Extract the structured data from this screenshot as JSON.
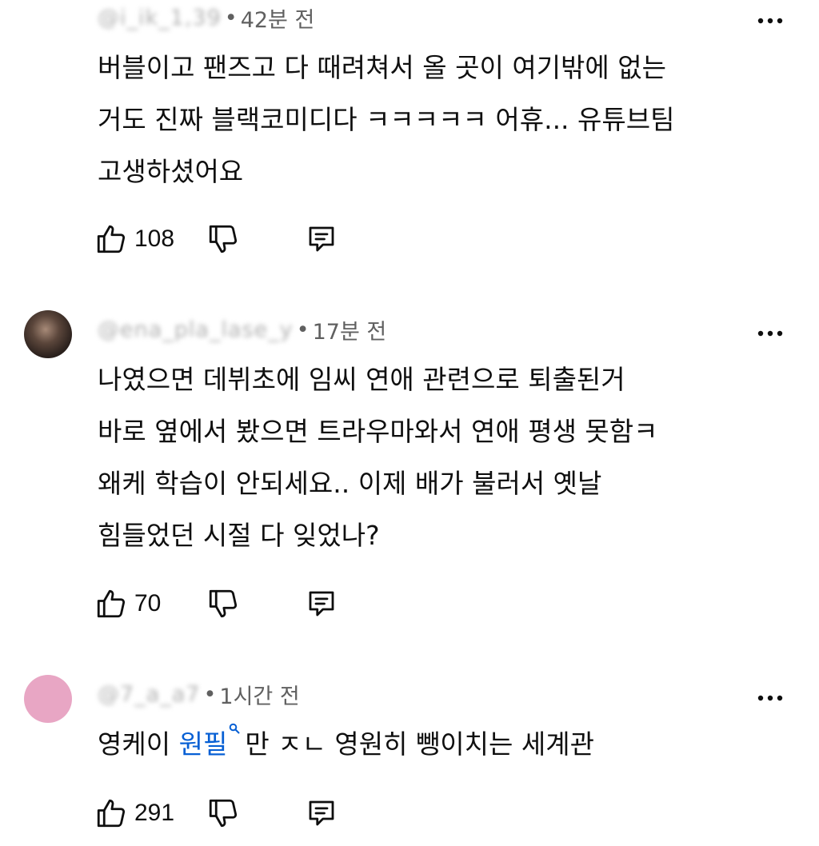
{
  "comments": [
    {
      "handle": "@i_ik_1,39",
      "time": "42분 전",
      "lines": [
        "버블이고 팬즈고 다 때려쳐서 올 곳이 여기밖에 없는",
        "거도 진짜 블랙코미디다 ㅋㅋㅋㅋㅋ 어휴... 유튜브팀",
        "고생하셨어요"
      ],
      "likes": "108"
    },
    {
      "handle": "@ena_pla_lase_y",
      "time": "17분 전",
      "lines": [
        "나였으면 데뷔초에 임씨 연애 관련으로 퇴출된거",
        "바로 옆에서 봤으면 트라우마와서 연애 평생 못함ㅋ",
        "왜케 학습이 안되세요.. 이제 배가 불러서 옛날",
        "힘들었던 시절 다 잊었나?"
      ],
      "likes": "70"
    },
    {
      "handle": "@7_a_a7",
      "time": "1시간 전",
      "text_before": "영케이 ",
      "hashtag": "원필",
      "text_after": "만 ㅈㄴ 영원히 뺑이치는 세계관",
      "likes": "291"
    }
  ],
  "icons": {
    "like": "thumbs-up-icon",
    "dislike": "thumbs-down-icon",
    "reply": "reply-comment-icon",
    "more": "more-vertical-icon"
  },
  "colors": {
    "text": "#0f0f0f",
    "meta": "#606060",
    "hashtag": "#065fd4",
    "avatar_pink": "#e8a6c4"
  }
}
